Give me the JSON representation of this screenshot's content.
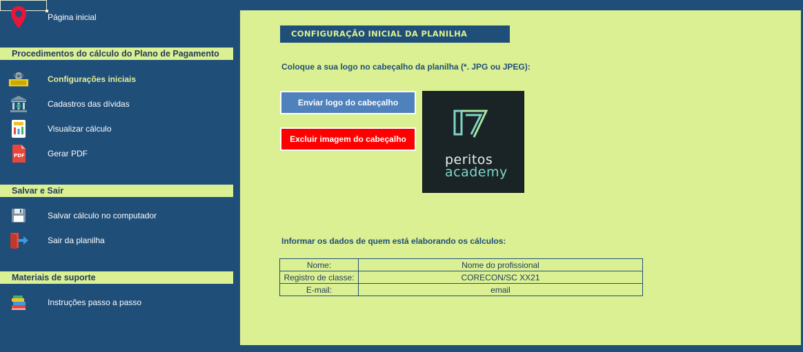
{
  "sidebar": {
    "home": {
      "label": "Página inicial",
      "icon": "map-pin-icon"
    },
    "sections": [
      {
        "title": "Procedimentos do cálculo do Plano de Pagamento",
        "items": [
          {
            "label": "Configurações iniciais",
            "icon": "settings-money-icon",
            "active": true
          },
          {
            "label": "Cadastros das dívidas",
            "icon": "bank-icon"
          },
          {
            "label": "Visualizar cálculo",
            "icon": "calculator-icon"
          },
          {
            "label": "Gerar PDF",
            "icon": "pdf-icon"
          }
        ]
      },
      {
        "title": "Salvar e Sair",
        "items": [
          {
            "label": "Salvar cálculo no computador",
            "icon": "floppy-disk-icon"
          },
          {
            "label": "Sair da planilha",
            "icon": "exit-door-icon"
          }
        ]
      },
      {
        "title": "Materiais de suporte",
        "items": [
          {
            "label": "Instruções passo a passo",
            "icon": "books-icon"
          }
        ]
      }
    ]
  },
  "main": {
    "title": "CONFIGURAÇÃO INICIAL DA PLANILHA",
    "instruction": "Coloque a sua logo no cabeçalho da planilha (*. JPG ou JPEG):",
    "upload_button": "Enviar logo do cabeçalho",
    "delete_button": "Excluir imagem do cabeçalho",
    "logo": {
      "line1": "peritos",
      "line2": "academy"
    },
    "info_label": "Informar os dados de quem está elaborando os cálculos:",
    "info_rows": [
      {
        "key": "Nome:",
        "value": "Nome do profissional"
      },
      {
        "key": "Registro de classe:",
        "value": "CORECON/SC XX21"
      },
      {
        "key": "E-mail:",
        "value": "email"
      }
    ]
  },
  "colors": {
    "background": "#1f4e79",
    "panel": "#dbf092",
    "upload_button": "#4f81bd",
    "delete_button": "#ff0000",
    "active_label": "#e2ef9a"
  }
}
